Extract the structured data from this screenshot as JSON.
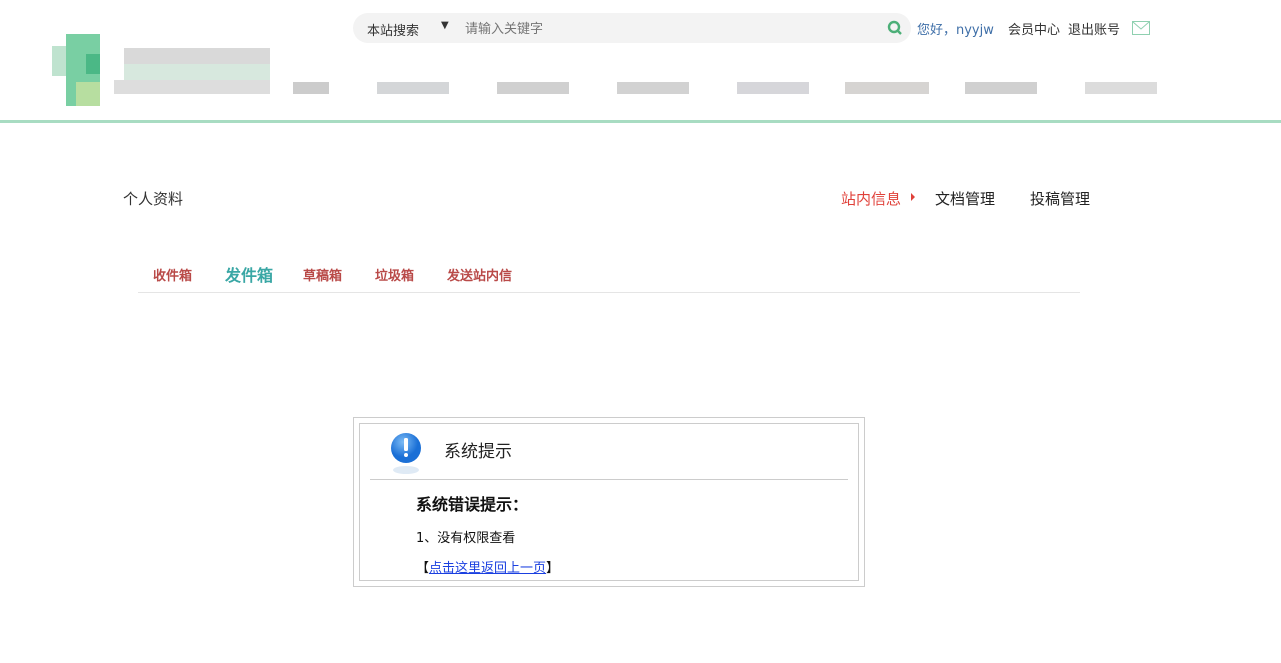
{
  "search": {
    "scope": "本站搜索",
    "placeholder": "请输入关键字"
  },
  "user": {
    "greeting": "您好，nyyjw",
    "member_center": "会员中心",
    "logout": "退出账号"
  },
  "profile_nav": {
    "left": "个人资料",
    "items": [
      "站内信息",
      "文档管理",
      "投稿管理"
    ]
  },
  "tabs": [
    "收件箱",
    "发件箱",
    "草稿箱",
    "垃圾箱",
    "发送站内信"
  ],
  "dialog": {
    "title": "系统提示",
    "heading": "系统错误提示：",
    "message": "1、没有权限查看",
    "link_prefix": "【",
    "link": "点击这里返回上一页",
    "link_suffix": "】"
  },
  "colors": {
    "accent_green": "#a8dcc2",
    "active_red": "#e0413a",
    "tab_red": "#b94a48",
    "tab_active": "#3aa7a5"
  }
}
